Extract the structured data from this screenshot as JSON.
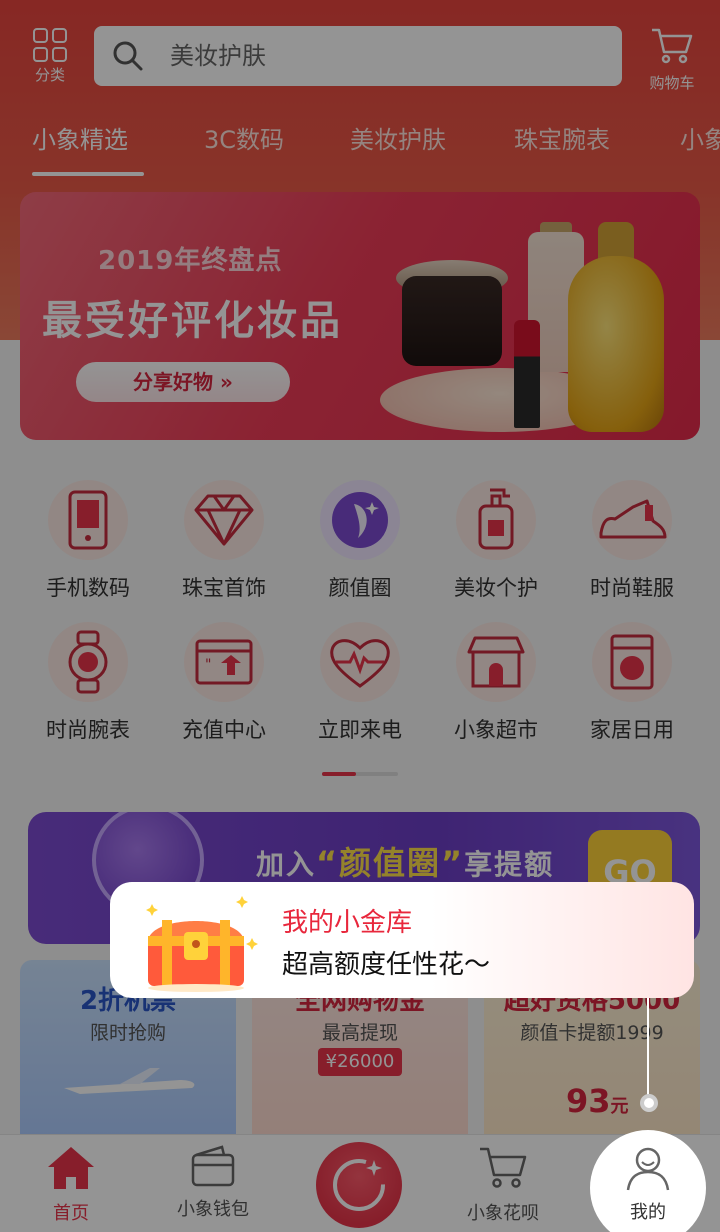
{
  "header": {
    "category_label": "分类",
    "search_placeholder": "美妆护肤",
    "cart_label": "购物车",
    "tabs": [
      {
        "label": "小象精选"
      },
      {
        "label": "3C数码"
      },
      {
        "label": "美妆护肤"
      },
      {
        "label": "珠宝腕表"
      },
      {
        "label": "小象"
      }
    ]
  },
  "banner": {
    "subtitle": "2019年终盘点",
    "title": "最受好评化妆品",
    "cta": "分享好物 »"
  },
  "categories": [
    {
      "label": "手机数码",
      "icon": "phone-icon"
    },
    {
      "label": "珠宝首饰",
      "icon": "diamond-icon"
    },
    {
      "label": "颜值圈",
      "icon": "face-circle-icon"
    },
    {
      "label": "美妆个护",
      "icon": "lotion-bottle-icon"
    },
    {
      "label": "时尚鞋服",
      "icon": "shoe-icon"
    },
    {
      "label": "时尚腕表",
      "icon": "watch-icon"
    },
    {
      "label": "充值中心",
      "icon": "recharge-icon"
    },
    {
      "label": "立即来电",
      "icon": "heartbeat-icon"
    },
    {
      "label": "小象超市",
      "icon": "store-icon"
    },
    {
      "label": "家居日用",
      "icon": "washing-machine-icon"
    }
  ],
  "promo": {
    "prefix": "加入",
    "highlight": "“颜值圈”",
    "suffix": "享提额",
    "go": "GO"
  },
  "cards": [
    {
      "title": "2折机票",
      "subtitle": "限时抢购"
    },
    {
      "title": "全网购物金",
      "subtitle": "最高提现",
      "price": "¥26000"
    },
    {
      "title": "超好资格5000",
      "subtitle": "颜值卡提额1999",
      "amount": "93",
      "unit": "元"
    }
  ],
  "tooltip": {
    "title": "我的小金库",
    "text": "超高额度任性花～"
  },
  "bottom_nav": {
    "home": "首页",
    "wallet": "小象钱包",
    "huabei": "小象花呗",
    "mine": "我的"
  },
  "colors": {
    "brand": "#e8354a",
    "header": "#e8453f",
    "promo": "#6c3ec6"
  }
}
